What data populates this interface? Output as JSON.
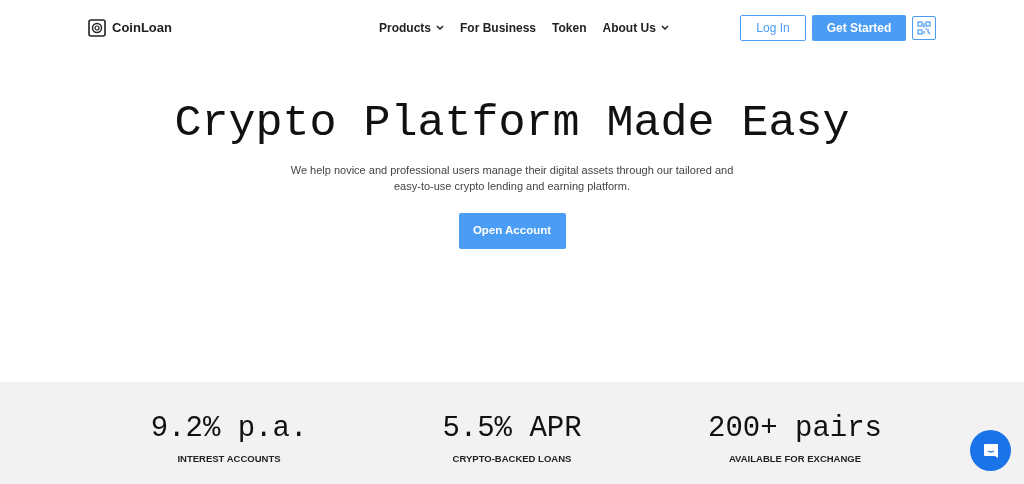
{
  "header": {
    "logo": "CoinLoan",
    "nav": [
      {
        "label": "Products",
        "has_dropdown": true
      },
      {
        "label": "For Business",
        "has_dropdown": false
      },
      {
        "label": "Token",
        "has_dropdown": false
      },
      {
        "label": "About Us",
        "has_dropdown": true
      }
    ],
    "login": "Log In",
    "get_started": "Get Started"
  },
  "hero": {
    "title": "Crypto Platform Made Easy",
    "subtitle": "We help novice and professional users manage their digital assets through our tailored and easy-to-use crypto lending and earning platform.",
    "cta": "Open Account"
  },
  "stats": [
    {
      "value": "9.2% p.a.",
      "label": "INTEREST ACCOUNTS"
    },
    {
      "value": "5.5% APR",
      "label": "CRYPTO-BACKED LOANS"
    },
    {
      "value": "200+ pairs",
      "label": "AVAILABLE FOR EXCHANGE"
    }
  ]
}
